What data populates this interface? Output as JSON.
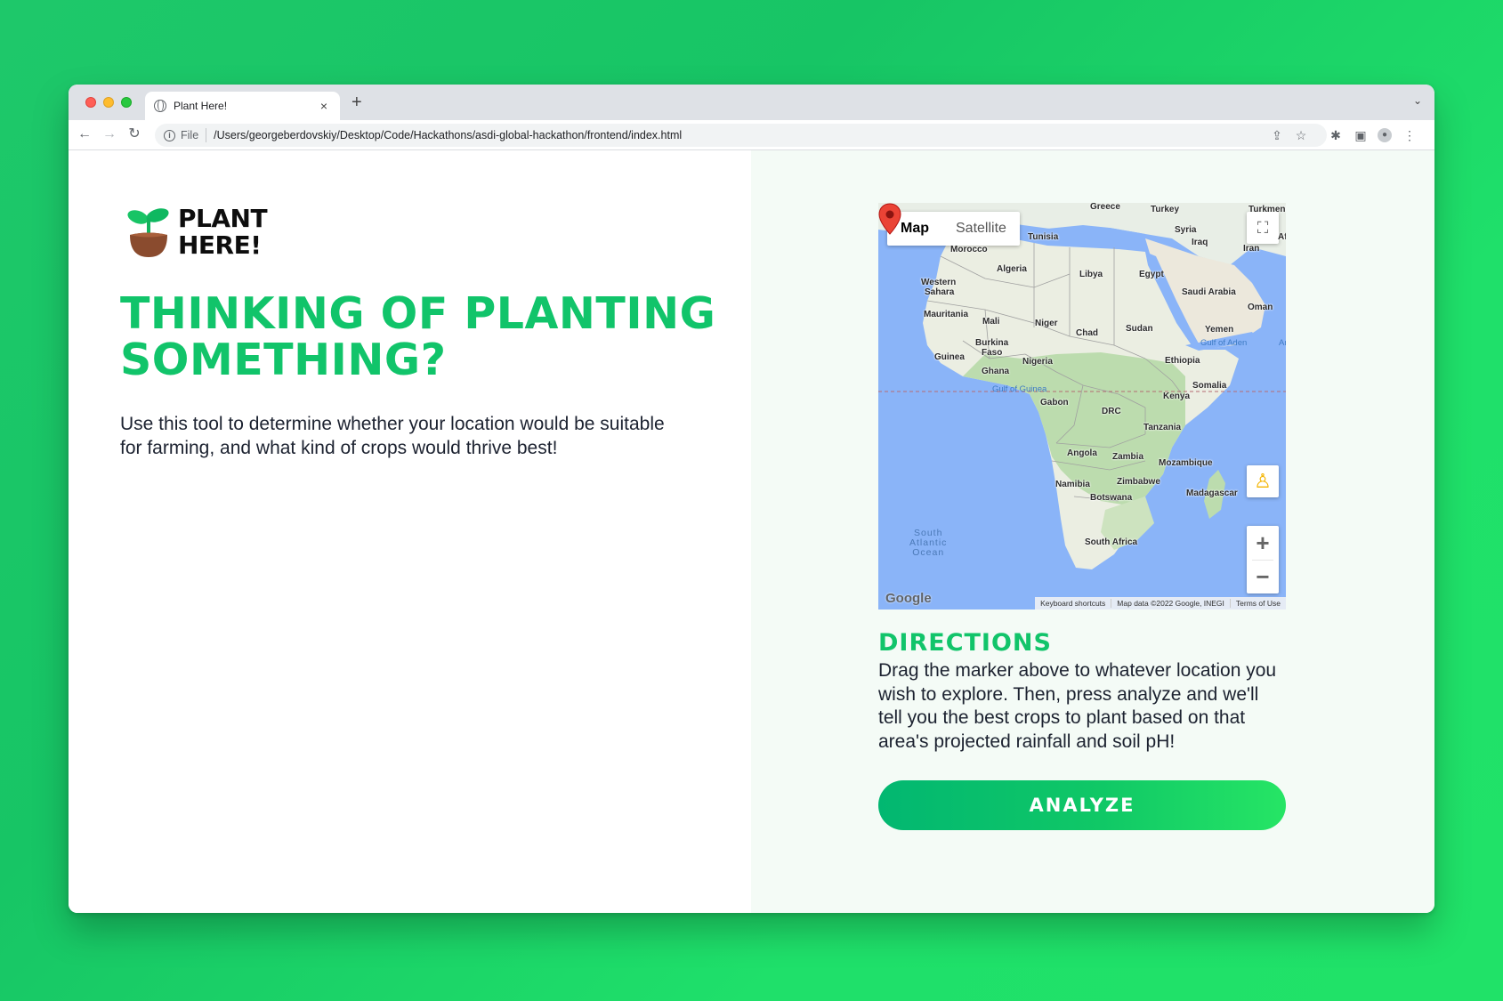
{
  "browser": {
    "tab_title": "Plant Here!",
    "tab_close": "×",
    "new_tab": "+",
    "tab_menu": "⌄",
    "file_label": "File",
    "url": "/Users/georgeberdovskiy/Desktop/Code/Hackathons/asdi-global-hackathon/frontend/index.html",
    "icons": [
      "back-icon",
      "forward-icon",
      "reload-icon",
      "info-icon",
      "share-icon",
      "star-icon",
      "extensions-icon",
      "sidepanel-icon",
      "profile-icon",
      "menu-icon"
    ]
  },
  "logo": {
    "line1": "PLANT",
    "line2": "HERE!"
  },
  "hero": {
    "headline_line1": "THINKING OF PLANTING",
    "headline_line2": "SOMETHING?",
    "intro": "Use this tool to determine whether your location would be suitable for farming, and what kind of crops would thrive best!"
  },
  "map": {
    "type_map": "Map",
    "type_satellite": "Satellite",
    "zoom_in": "+",
    "zoom_out": "−",
    "footer": {
      "shortcuts": "Keyboard shortcuts",
      "data": "Map data ©2022 Google, INEGI",
      "terms": "Terms of Use"
    },
    "google": "Google",
    "ocean_label": [
      "South",
      "Atlantic",
      "Ocean"
    ],
    "labels": {
      "greece": "Greece",
      "turkey": "Turkey",
      "turkmeni": "Turkmeni",
      "tunisia": "Tunisia",
      "syria": "Syria",
      "iraq": "Iraq",
      "iran": "Iran",
      "af": "Af",
      "morocco": "Morocco",
      "algeria": "Algeria",
      "libya": "Libya",
      "egypt": "Egypt",
      "western": "Western",
      "sahara": "Sahara",
      "saudi": "Saudi Arabia",
      "mauritania": "Mauritania",
      "oman": "Oman",
      "mali": "Mali",
      "niger": "Niger",
      "chad": "Chad",
      "sudan": "Sudan",
      "yemen": "Yemen",
      "burkina": "Burkina",
      "faso": "Faso",
      "guinea": "Guinea",
      "nigeria": "Nigeria",
      "ghana": "Ghana",
      "ethiopia": "Ethiopia",
      "gulf_aden": "Gulf of Aden",
      "gulf_guinea": "Gulf of Guinea",
      "somalia": "Somalia",
      "gabon": "Gabon",
      "kenya": "Kenya",
      "drc": "DRC",
      "tanzania": "Tanzania",
      "angola": "Angola",
      "zambia": "Zambia",
      "mozambique": "Mozambique",
      "namibia": "Namibia",
      "zimbabwe": "Zimbabwe",
      "botswana": "Botswana",
      "madagascar": "Madagascar",
      "south_africa": "South Africa",
      "ar": "Ar"
    },
    "colors": {
      "water": "#8ab4f8",
      "land": "#e8eee6",
      "green_land": "#bcdcae",
      "marker": "#ea4335"
    }
  },
  "directions": {
    "title": "DIRECTIONS",
    "text": "Drag the marker above to whatever location you wish to explore. Then, press analyze and we'll tell you the best crops to plant based on that area's projected rainfall and soil pH!"
  },
  "analyze_button": "ANALYZE",
  "colors": {
    "brand_green": "#11c46a",
    "text_dark": "#1c2230",
    "right_pane_bg": "#f4fbf6"
  }
}
